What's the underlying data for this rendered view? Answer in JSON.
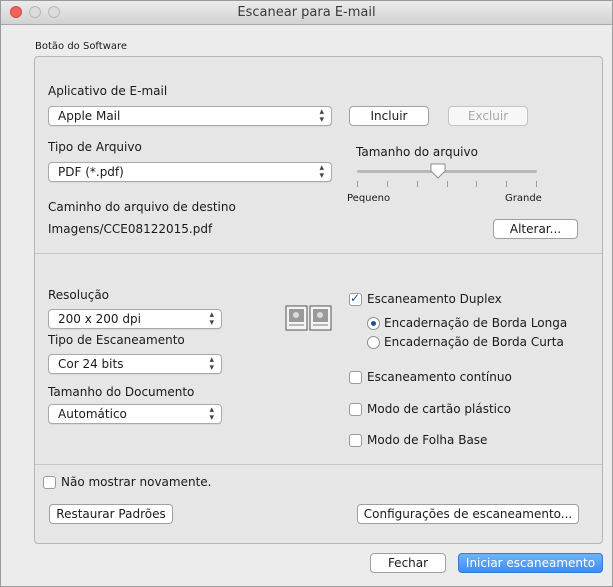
{
  "window": {
    "title": "Escanear para E-mail"
  },
  "section_label": "Botão do Software",
  "email_app": {
    "label": "Aplicativo de E-mail",
    "selected": "Apple Mail",
    "include_button": "Incluir",
    "exclude_button": "Excluir"
  },
  "file_type": {
    "label": "Tipo de Arquivo",
    "selected": "PDF (*.pdf)"
  },
  "file_size": {
    "label": "Tamanho do arquivo",
    "min_label": "Pequeno",
    "max_label": "Grande",
    "value_fraction": 0.45
  },
  "destination": {
    "label": "Caminho do arquivo de destino",
    "path": "Imagens/CCE08122015.pdf",
    "change_button": "Alterar..."
  },
  "resolution": {
    "label": "Resolução",
    "selected": "200 x 200 dpi"
  },
  "scan_type": {
    "label": "Tipo de Escaneamento",
    "selected": "Cor 24 bits"
  },
  "document_size": {
    "label": "Tamanho do Documento",
    "selected": "Automático"
  },
  "duplex": {
    "label": "Escaneamento Duplex",
    "checked": true,
    "long_edge": "Encadernação de Borda Longa",
    "short_edge": "Encadernação de Borda Curta",
    "selected": "long_edge"
  },
  "continuous": {
    "label": "Escaneamento contínuo",
    "checked": false
  },
  "plastic_card": {
    "label": "Modo de cartão plástico",
    "checked": false
  },
  "carrier_sheet": {
    "label": "Modo de Folha Base",
    "checked": false
  },
  "dont_show": {
    "label": "Não mostrar novamente.",
    "checked": false
  },
  "restore_button": "Restaurar Padrões",
  "scan_settings_button": "Configurações de escaneamento...",
  "close_button": "Fechar",
  "start_button": "Iniciar escaneamento"
}
